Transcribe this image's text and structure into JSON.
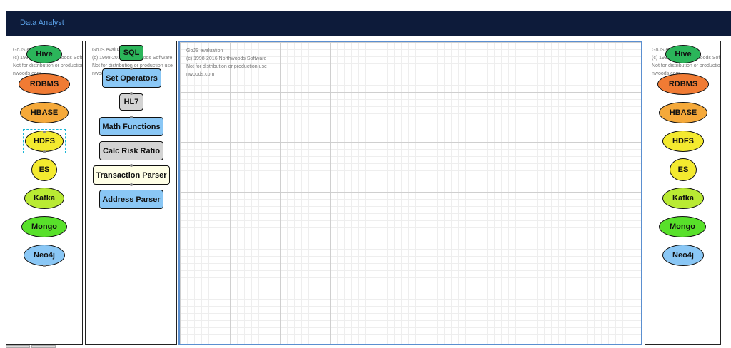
{
  "app": {
    "title": "Data Analyst"
  },
  "watermark": {
    "line1": "GoJS evaluation",
    "line2": "(c) 1998-2016 Northwoods Software",
    "line3": "Not for distribution or production use",
    "line4": "nwoods.com"
  },
  "left_palette": {
    "nodes": [
      {
        "label": "Hive",
        "color": "#2bb55a"
      },
      {
        "label": "RDBMS",
        "color": "#f07b34"
      },
      {
        "label": "HBASE",
        "color": "#f5a93a"
      },
      {
        "label": "HDFS",
        "color": "#f4ea2f"
      },
      {
        "label": "ES",
        "color": "#f4ea2f"
      },
      {
        "label": "Kafka",
        "color": "#b9ea33"
      },
      {
        "label": "Mongo",
        "color": "#58e02a"
      },
      {
        "label": "Neo4j",
        "color": "#8ac7f5"
      }
    ]
  },
  "mid_palette": {
    "nodes": [
      {
        "label": "SQL",
        "color": "#2bb55a"
      },
      {
        "label": "Set Operators",
        "color": "#8ac7f5"
      },
      {
        "label": "HL7",
        "color": "#d3d3d3"
      },
      {
        "label": "Math Functions",
        "color": "#8ac7f5"
      },
      {
        "label": "Calc Risk Ratio",
        "color": "#d3d3d3"
      },
      {
        "label": "Transaction Parser",
        "color": "#ffffe6"
      },
      {
        "label": "Address Parser",
        "color": "#8ac7f5"
      }
    ]
  },
  "right_palette": {
    "nodes": [
      {
        "label": "Hive",
        "color": "#2bb55a"
      },
      {
        "label": "RDBMS",
        "color": "#f07b34"
      },
      {
        "label": "HBASE",
        "color": "#f5a93a"
      },
      {
        "label": "HDFS",
        "color": "#f4ea2f"
      },
      {
        "label": "ES",
        "color": "#f4ea2f"
      },
      {
        "label": "Kafka",
        "color": "#b9ea33"
      },
      {
        "label": "Mongo",
        "color": "#58e02a"
      },
      {
        "label": "Neo4j",
        "color": "#8ac7f5"
      }
    ]
  }
}
